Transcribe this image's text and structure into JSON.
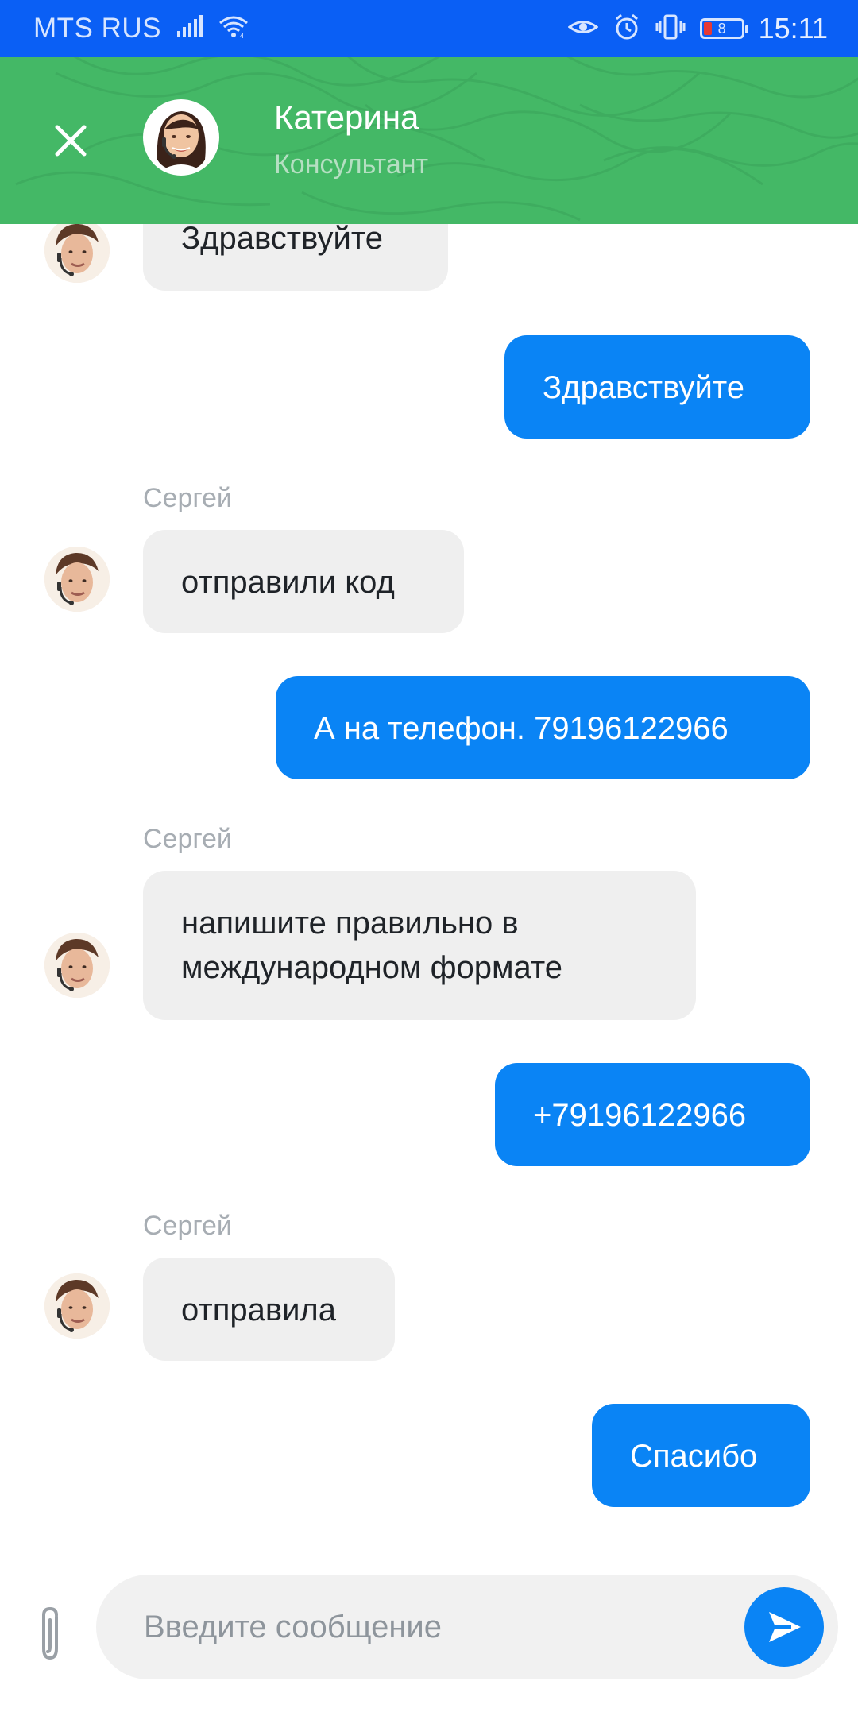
{
  "status_bar": {
    "carrier": "MTS RUS",
    "battery_level": "8",
    "time": "15:11",
    "icons": [
      "signal-icon",
      "wifi-icon",
      "eye-comfort-icon",
      "alarm-icon",
      "vibrate-icon",
      "battery-icon"
    ]
  },
  "header": {
    "agent_name": "Катерина",
    "agent_role": "Консультант",
    "header_color": "#44b866",
    "close_icon": "close-icon"
  },
  "messages": [
    {
      "direction": "in",
      "text": "Здравствуйте"
    },
    {
      "direction": "out",
      "text": "Здравствуйте"
    },
    {
      "direction": "in",
      "sender": "Сергей",
      "text": "отправили код"
    },
    {
      "direction": "out",
      "text": "А на телефон. 79196122966"
    },
    {
      "direction": "in",
      "sender": "Сергей",
      "text": "напишите правильно в международном формате"
    },
    {
      "direction": "out",
      "text": "+79196122966"
    },
    {
      "direction": "in",
      "sender": "Сергей",
      "text": "отправила"
    },
    {
      "direction": "out",
      "text": "Спасибо"
    }
  ],
  "composer": {
    "placeholder": "Введите сообщение",
    "attach_icon": "paperclip-icon",
    "send_icon": "send-icon"
  },
  "colors": {
    "status_bar": "#0a5ff5",
    "outgoing_bubble": "#0a84f5",
    "incoming_bubble": "#efefef",
    "sender_label": "#a7adb3"
  }
}
